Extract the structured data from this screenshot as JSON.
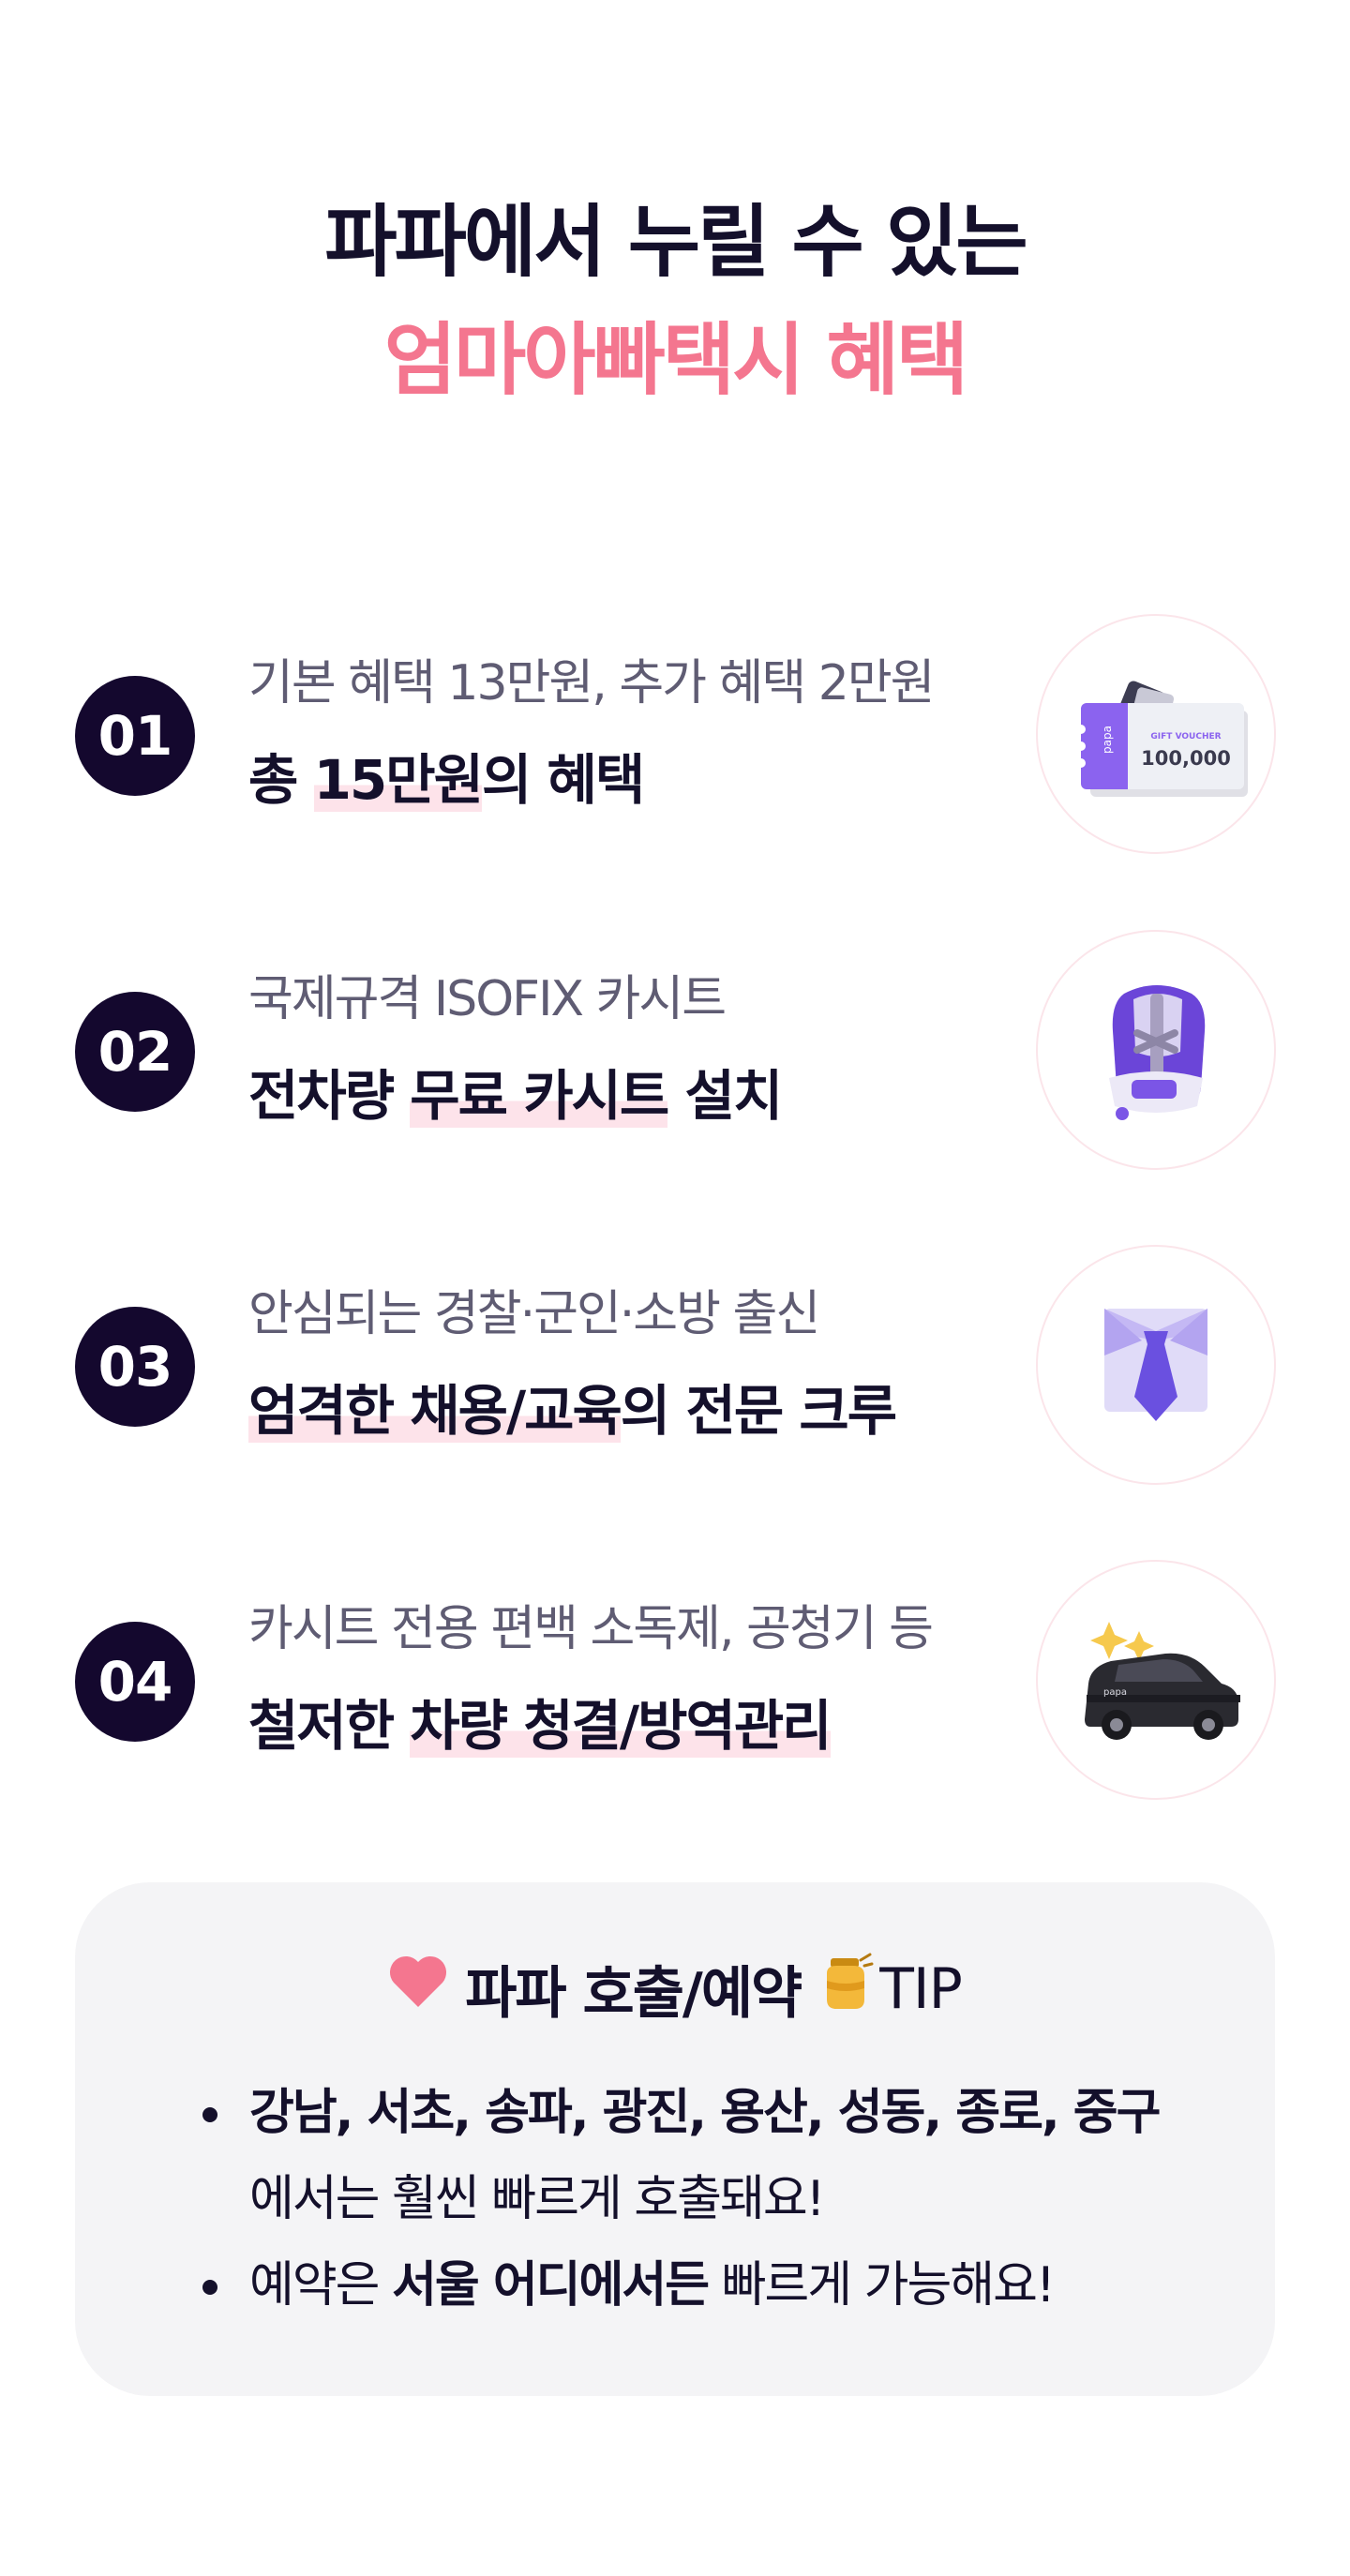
{
  "hero": {
    "line1": "파파에서 누릴 수 있는",
    "line2": "엄마아빠택시 혜택"
  },
  "benefits": [
    {
      "number": "01",
      "sub": "기본 혜택 13만원, 추가 혜택 2만원",
      "main_before": "총 ",
      "main_highlight": "15만원",
      "main_after": "의 혜택",
      "icon": "gift-voucher-icon",
      "voucher_label": "GIFT VOUCHER",
      "voucher_amount": "100,000",
      "voucher_brand": "papa"
    },
    {
      "number": "02",
      "sub": "국제규격 ISOFIX 카시트",
      "main_before": "전차량 ",
      "main_highlight": "무료 카시트",
      "main_after": " 설치",
      "icon": "car-seat-icon"
    },
    {
      "number": "03",
      "sub": "안심되는 경찰·군인·소방 출신",
      "main_before": "",
      "main_highlight": "엄격한 채용/교육",
      "main_after": "의 전문 크루",
      "icon": "shirt-tie-icon"
    },
    {
      "number": "04",
      "sub": "카시트 전용 편백 소독제, 공청기 등",
      "main_before": "철저한 ",
      "main_highlight": "차량 청결/방역관리",
      "main_after": "",
      "icon": "clean-car-icon",
      "car_brand": "papa"
    }
  ],
  "tip": {
    "title": "파파 호출/예약",
    "suffix": "TIP",
    "heart_icon": "heart-icon",
    "honey_icon": "honey-jar-icon",
    "item1_bold": "강남, 서초, 송파, 광진, 용산, 성동, 종로, 중구",
    "item1_rest": "에서는 훨씬 빠르게 호출돼요!",
    "item2_pre": "예약은 ",
    "item2_bold": "서울 어디에서든",
    "item2_post": " 빠르게 가능해요!"
  },
  "colors": {
    "accent_pink": "#f4768f",
    "navy": "#14082e",
    "highlight": "#fde3ea",
    "purple": "#7a5cf0"
  }
}
